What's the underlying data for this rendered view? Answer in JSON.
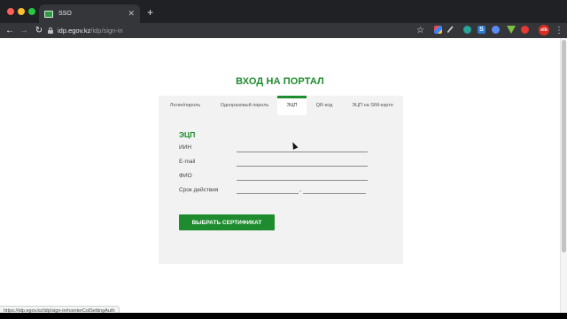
{
  "browser": {
    "tab_title": "SSO",
    "tab_close": "✕",
    "new_tab": "+",
    "url_host": "idp.egov.kz",
    "url_path": "/idp/sign-in",
    "back": "←",
    "forward": "→",
    "reload": "↻",
    "star": "☆",
    "menu": "⋮",
    "ext_letter": "S",
    "avatar_text": "olb",
    "icons": [
      "back-arrow-icon",
      "forward-arrow-icon",
      "reload-icon",
      "lock-icon",
      "star-icon",
      "menu-dots-icon"
    ]
  },
  "page": {
    "title": "ВХОД НА ПОРТАЛ",
    "tabs": [
      {
        "label": "Логин/пароль",
        "active": false
      },
      {
        "label": "Одноразовый пароль",
        "active": false
      },
      {
        "label": "ЭЦП",
        "active": true
      },
      {
        "label": "QR-код",
        "active": false
      },
      {
        "label": "ЭЦП на SIM-карте",
        "active": false
      }
    ],
    "section_title": "ЭЦП",
    "fields": {
      "iin": "ИИН",
      "email": "E-mail",
      "fio": "ФИО",
      "validity": "Срок действия",
      "validity_separator": "-"
    },
    "button_label": "ВЫБРАТЬ СЕРТИФИКАТ",
    "accent_color": "#1e8c2e"
  },
  "status_url": "https://idp.egov.kz/idp/sign-in#centerColSettingAuth"
}
